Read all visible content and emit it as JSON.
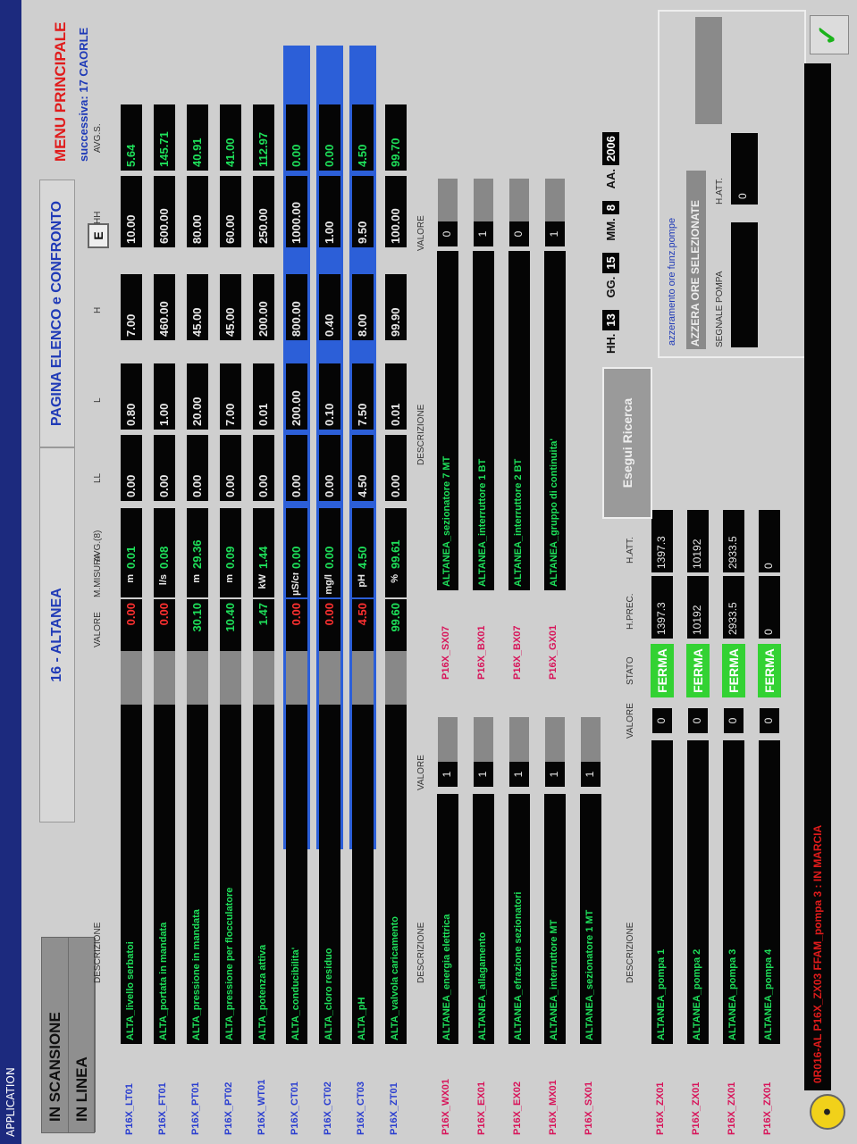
{
  "window_title": "APPLICATION",
  "status": [
    "IN SCANSIONE",
    "IN LINEA"
  ],
  "station": "16 - ALTANEA",
  "page_title": "PAGINA ELENCO e CONFRONTO",
  "menu": "MENU PRINCIPALE",
  "next_page": "successiva: 17 CAORLE",
  "e_button": "E",
  "headers": {
    "descr": "DESCRIZIONE",
    "valore": "VALORE",
    "misura": "M.MISURA",
    "avg": "AVG.(8)",
    "ll": "LL",
    "l": "L",
    "h": "H",
    "hh": "HH",
    "avgs": "AVG.S."
  },
  "analog": [
    {
      "tag": "P16X_LT01",
      "desc": "ALTA_livello serbatoi",
      "val": "0.00",
      "red": true,
      "unit": "m",
      "avg": "0.01",
      "ll": "0.00",
      "l": "0.80",
      "h": "7.00",
      "hh": "10.00",
      "avgs": "5.64"
    },
    {
      "tag": "P16X_FT01",
      "desc": "ALTA_portata in mandata",
      "val": "0.00",
      "red": true,
      "unit": "l/s",
      "avg": "0.08",
      "ll": "0.00",
      "l": "1.00",
      "h": "460.00",
      "hh": "600.00",
      "avgs": "145.71"
    },
    {
      "tag": "P16X_PT01",
      "desc": "ALTA_pressione in mandata",
      "val": "30.10",
      "red": false,
      "unit": "m",
      "avg": "29.36",
      "ll": "0.00",
      "l": "20.00",
      "h": "45.00",
      "hh": "80.00",
      "avgs": "40.91"
    },
    {
      "tag": "P16X_PT02",
      "desc": "ALTA_pressione per flocculatore",
      "val": "10.40",
      "red": false,
      "unit": "m",
      "avg": "0.09",
      "ll": "0.00",
      "l": "7.00",
      "h": "45.00",
      "hh": "60.00",
      "avgs": "41.00"
    },
    {
      "tag": "P16X_WT01",
      "desc": "ALTA_potenza attiva",
      "val": "1.47",
      "red": false,
      "unit": "kW",
      "avg": "1.44",
      "ll": "0.00",
      "l": "0.01",
      "h": "200.00",
      "hh": "250.00",
      "avgs": "112.97"
    },
    {
      "tag": "P16X_CT01",
      "desc": "ALTA_conducibilita'",
      "val": "0.00",
      "red": true,
      "unit": "µS/cm",
      "avg": "0.00",
      "ll": "0.00",
      "l": "200.00",
      "h": "800.00",
      "hh": "1000.00",
      "avgs": "0.00",
      "sel": true
    },
    {
      "tag": "P16X_CT02",
      "desc": "ALTA_cloro residuo",
      "val": "0.00",
      "red": true,
      "unit": "mg/l",
      "avg": "0.00",
      "ll": "0.00",
      "l": "0.10",
      "h": "0.40",
      "hh": "1.00",
      "avgs": "0.00",
      "sel": true
    },
    {
      "tag": "P16X_CT03",
      "desc": "ALTA_pH",
      "val": "4.50",
      "red": true,
      "unit": "pH",
      "avg": "4.50",
      "ll": "4.50",
      "l": "7.50",
      "h": "8.00",
      "hh": "9.50",
      "avgs": "4.50",
      "sel": true
    },
    {
      "tag": "P16X_ZT01",
      "desc": "ALTA_valvola caricamento",
      "val": "99.60",
      "red": false,
      "unit": "%",
      "avg": "99.61",
      "ll": "0.00",
      "l": "0.01",
      "h": "99.90",
      "hh": "100.00",
      "avgs": "99.70"
    }
  ],
  "digital_headers": {
    "descr": "DESCRIZIONE",
    "valore": "VALORE"
  },
  "digital_left": [
    {
      "tag": "P16X_WX01",
      "desc": "ALTANEA_energia elettrica",
      "val": "1"
    },
    {
      "tag": "P16X_EX01",
      "desc": "ALTANEA_allagamento",
      "val": "1"
    },
    {
      "tag": "P16X_EX02",
      "desc": "ALTANEA_efrazione sezionatori",
      "val": "1"
    },
    {
      "tag": "P16X_MX01",
      "desc": "ALTANEA_interruttore MT",
      "val": "1"
    },
    {
      "tag": "P16X_SX01",
      "desc": "ALTANEA_sezionatore 1 MT",
      "val": "1"
    }
  ],
  "digital_right": [
    {
      "tag": "P16X_SX07",
      "desc": "ALTANEA_sezionatore 7 MT",
      "val": "0"
    },
    {
      "tag": "P16X_BX01",
      "desc": "ALTANEA_interruttore 1 BT",
      "val": "1"
    },
    {
      "tag": "P16X_BX07",
      "desc": "ALTANEA_interruttore 2 BT",
      "val": "0"
    },
    {
      "tag": "P16X_GX01",
      "desc": "ALTANEA_gruppo di continuita'",
      "val": "1"
    }
  ],
  "pump_headers": {
    "descr": "DESCRIZIONE",
    "valore": "VALORE",
    "stato": "STATO",
    "hprec": "H.PREC.",
    "hatt": "H.ATT."
  },
  "pumps": [
    {
      "tag": "P16X_ZX01",
      "desc": "ALTANEA_pompa 1",
      "val": "0",
      "stato": "FERMA",
      "hprec": "1397.3",
      "hatt": "1397.3"
    },
    {
      "tag": "P16X_ZX01",
      "desc": "ALTANEA_pompa 2",
      "val": "0",
      "stato": "FERMA",
      "hprec": "10192",
      "hatt": "10192"
    },
    {
      "tag": "P16X_ZX01",
      "desc": "ALTANEA_pompa 3",
      "val": "0",
      "stato": "FERMA",
      "hprec": "2933.5",
      "hatt": "2933.5"
    },
    {
      "tag": "P16X_ZX01",
      "desc": "ALTANEA_pompa 4",
      "val": "0",
      "stato": "FERMA",
      "hprec": "0",
      "hatt": "0"
    }
  ],
  "button_refresh": "Esegui Ricerca",
  "clock": {
    "hh_label": "HH.",
    "hh": "13",
    "gg_label": "GG.",
    "gg": "15",
    "mm_label": "MM.",
    "mm": "8",
    "aa_label": "AA.",
    "aa": "2006"
  },
  "reset_panel": {
    "hint": "azzeramento ore funz.pompe",
    "button": "AZZERA ORE SELEZIONATE",
    "signal_label": "SEGNALE POMPA",
    "hatt_label": "H.ATT.",
    "hatt_value": "0"
  },
  "alarm_line": "0R016-AL  P16X_ZX03  FFAM_pompa 3 : IN MARCIA",
  "ok_symbol": "✓",
  "colors": {
    "accent": "#1c2a7e",
    "ok_green": "#33d233",
    "alarm_red": "#e01b1b",
    "value_green": "#1ee05a",
    "select_blue": "#2c5fd8"
  }
}
